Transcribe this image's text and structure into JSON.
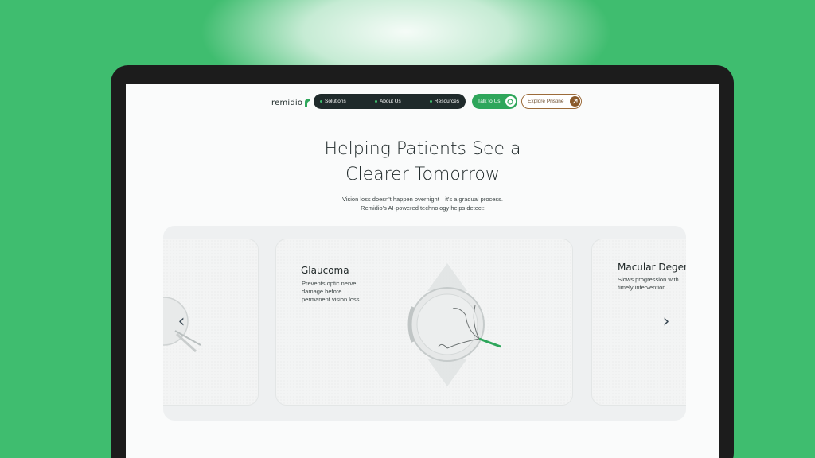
{
  "nav": {
    "brand": "remidio",
    "items": [
      {
        "label": "Solutions"
      },
      {
        "label": "About Us"
      },
      {
        "label": "Resources"
      }
    ],
    "talk_label": "Talk to Us",
    "explore_label": "Explore Pristine"
  },
  "hero": {
    "title_line1": "Helping Patients See a",
    "title_line2": "Clearer Tomorrow",
    "subtitle_line1": "Vision loss doesn't happen overnight—it's a gradual process.",
    "subtitle_line2": "Remidio's AI-powered technology helps detect:"
  },
  "carousel": {
    "cards": [
      {
        "title": "",
        "desc": ""
      },
      {
        "title": "Glaucoma",
        "desc_lines": [
          "Prevents optic nerve",
          "damage before",
          "permanent vision loss."
        ]
      },
      {
        "title": "Macular Deger",
        "desc_lines": [
          "Slows progression with",
          "timely intervention."
        ]
      }
    ],
    "prev": "‹",
    "next": "›"
  },
  "colors": {
    "background": "#3fbd6f",
    "nav_dark": "#1f2a2b",
    "accent_green": "#2ea65b",
    "explore_brown": "#8a5a2b"
  },
  "icons": [
    "leaf-logo-icon",
    "chat-icon",
    "arrow-up-right-icon",
    "chevron-left-icon",
    "chevron-right-icon",
    "eye-illustration-icon"
  ]
}
